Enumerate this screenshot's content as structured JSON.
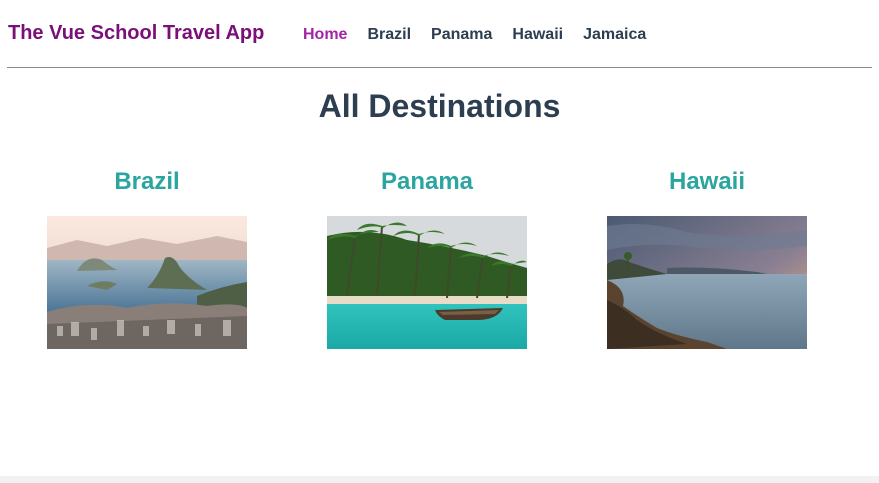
{
  "nav": {
    "brand": "The Vue School Travel App",
    "links": [
      {
        "label": "Home",
        "active": true
      },
      {
        "label": "Brazil"
      },
      {
        "label": "Panama"
      },
      {
        "label": "Hawaii"
      },
      {
        "label": "Jamaica"
      }
    ]
  },
  "page": {
    "title": "All Destinations"
  },
  "destinations": [
    {
      "name": "Brazil",
      "image": "rio-de-janeiro-image"
    },
    {
      "name": "Panama",
      "image": "tropical-beach-image"
    },
    {
      "name": "Hawaii",
      "image": "coastal-sunset-image"
    }
  ],
  "colors": {
    "brand": "#7a0f7a",
    "active_link": "#a324a7",
    "text": "#2c3e50",
    "destination_heading": "#2aa5a0"
  }
}
